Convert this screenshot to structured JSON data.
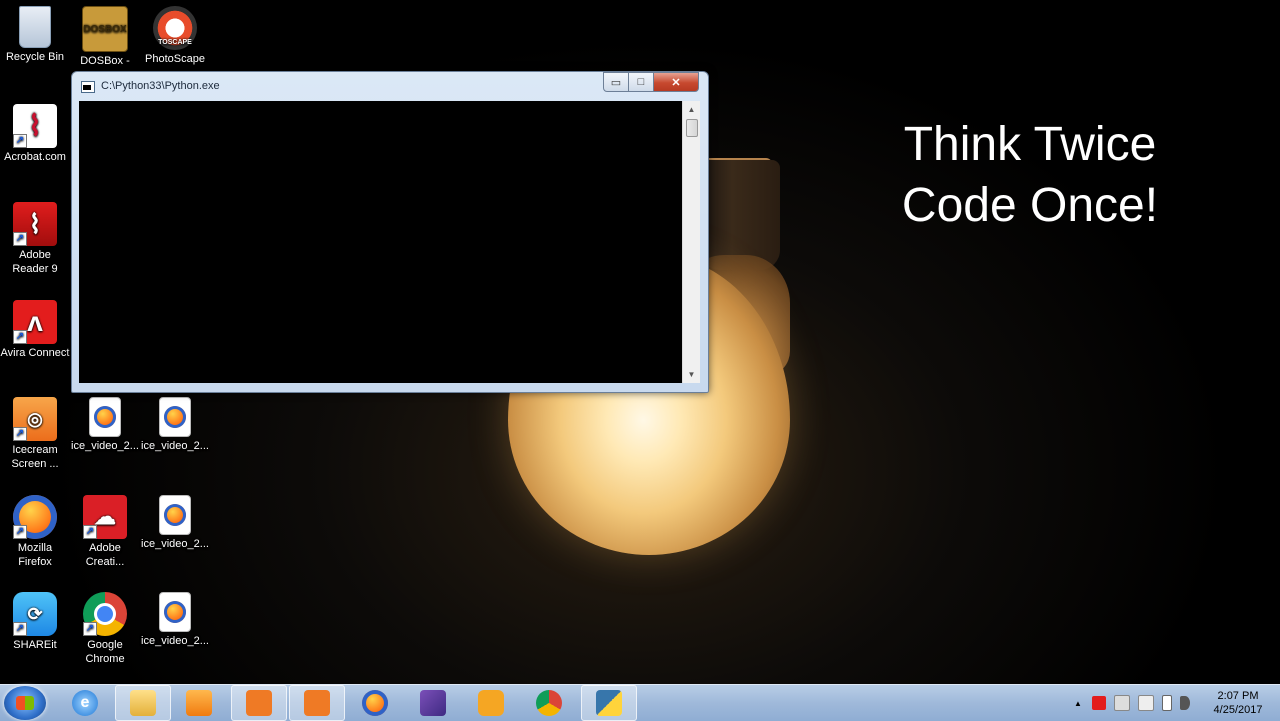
{
  "wallpaper": {
    "quote_line1": "Think Twice",
    "quote_line2": "Code Once!"
  },
  "desktop_icons": [
    {
      "label": "Recycle Bin",
      "icon": "recycle-bin-icon"
    },
    {
      "label": "DOSBox -",
      "icon": "dosbox-icon",
      "logo_text": "DOSBOX"
    },
    {
      "label": "PhotoScape",
      "icon": "photoscape-icon",
      "logo_text": "TOSCAPE"
    },
    {
      "label": "Acrobat.com",
      "icon": "acrobat-icon"
    },
    {
      "label": "Adobe Reader 9",
      "icon": "adobe-reader-icon"
    },
    {
      "label": "Avira Connect",
      "icon": "avira-icon"
    },
    {
      "label": "Icecream Screen ...",
      "icon": "icecream-icon"
    },
    {
      "label": "ice_video_2...",
      "icon": "firefox-document-icon"
    },
    {
      "label": "ice_video_2...",
      "icon": "firefox-document-icon"
    },
    {
      "label": "Mozilla Firefox",
      "icon": "firefox-icon"
    },
    {
      "label": "Adobe Creati...",
      "icon": "creative-cloud-icon"
    },
    {
      "label": "ice_video_2...",
      "icon": "firefox-document-icon"
    },
    {
      "label": "SHAREit",
      "icon": "shareit-icon"
    },
    {
      "label": "Google Chrome",
      "icon": "chrome-icon"
    },
    {
      "label": "ice_video_2...",
      "icon": "firefox-document-icon"
    }
  ],
  "console": {
    "title": "C:\\Python33\\Python.exe",
    "minimize_glyph": "▭",
    "maximize_glyph": "□",
    "close_glyph": "✕",
    "scroll_up": "▲",
    "scroll_down": "▼"
  },
  "taskbar": {
    "items": [
      {
        "icon": "internet-explorer-icon"
      },
      {
        "icon": "file-explorer-icon"
      },
      {
        "icon": "media-player-icon"
      },
      {
        "icon": "icecream-screen-recorder-icon"
      },
      {
        "icon": "camera-app-icon"
      },
      {
        "icon": "firefox-icon"
      },
      {
        "icon": "visual-studio-icon"
      },
      {
        "icon": "uc-browser-icon"
      },
      {
        "icon": "chrome-icon"
      },
      {
        "icon": "python-icon"
      }
    ],
    "tray_icons": [
      "show-hidden-icons-icon",
      "avira-tray-icon",
      "network-error-icon",
      "flag-icon",
      "battery-icon",
      "volume-icon"
    ],
    "tray_arrow": "▲",
    "clock_time": "2:07 PM",
    "clock_date": "4/25/2017"
  },
  "colors": {
    "taskbar_bg": "#9fb9da",
    "console_bg": "#000000",
    "quote_color": "#ffffff"
  }
}
